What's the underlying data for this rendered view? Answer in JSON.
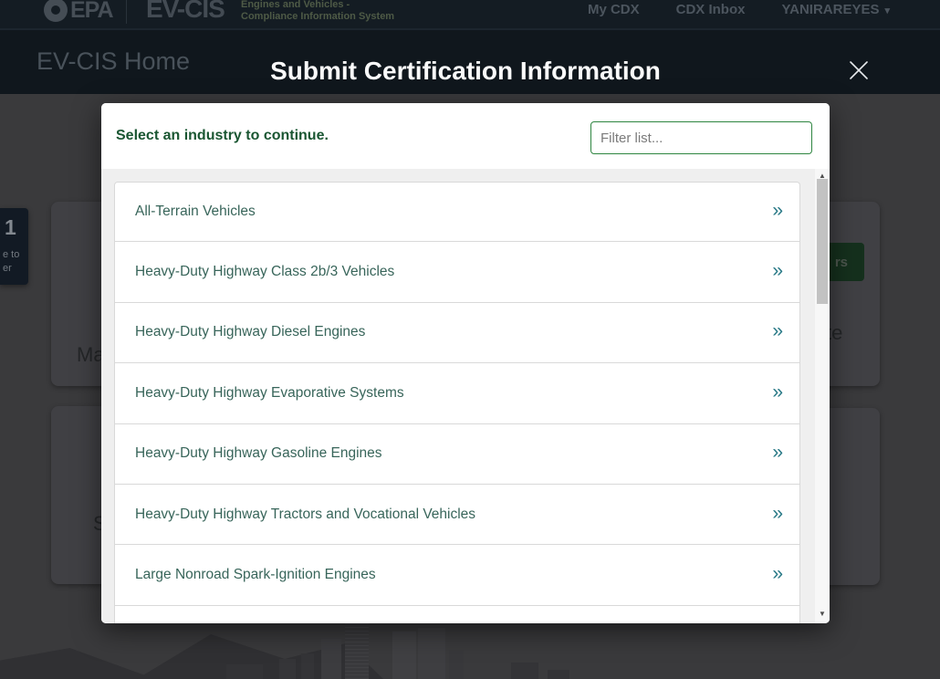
{
  "header": {
    "epa_logo": "EPA",
    "product_logo": "EV-CIS",
    "product_subtitle_line1": "Engines and Vehicles -",
    "product_subtitle_line2": "Compliance Information System",
    "nav": {
      "my_cdx": "My CDX",
      "cdx_inbox": "CDX Inbox",
      "user_name": "YANIRAREYES"
    }
  },
  "banner": {
    "page_title": "EV-CIS Home"
  },
  "modal": {
    "title": "Submit Certification Information",
    "prompt": "Select an industry to continue.",
    "filter_placeholder": "Filter list...",
    "industries": [
      "All-Terrain Vehicles",
      "Heavy-Duty Highway Class 2b/3 Vehicles",
      "Heavy-Duty Highway Diesel Engines",
      "Heavy-Duty Highway Evaporative Systems",
      "Heavy-Duty Highway Gasoline Engines",
      "Heavy-Duty Highway Tractors and Vocational Vehicles",
      "Large Nonroad Spark-Ignition Engines"
    ]
  },
  "background_page": {
    "badge_number": "1",
    "badge_text_line1": "e to",
    "badge_text_line2": "er",
    "card_left_top_text": "Ma",
    "card_left_bottom_text": "S",
    "card_right_top_text": "te",
    "green_button_text": "rs"
  },
  "icons": {
    "double_chevron_right": "»",
    "caret_down": "▾",
    "scroll_up": "▲",
    "scroll_down": "▼"
  },
  "colors": {
    "accent_green": "#2e8540",
    "prompt_green": "#1a5632",
    "list_item_green": "#38655a",
    "chevron_teal": "#2a7a87",
    "header_bg": "#141c23",
    "banner_bg": "#10171d",
    "overlay_page_bg": "#3a3a3c"
  }
}
